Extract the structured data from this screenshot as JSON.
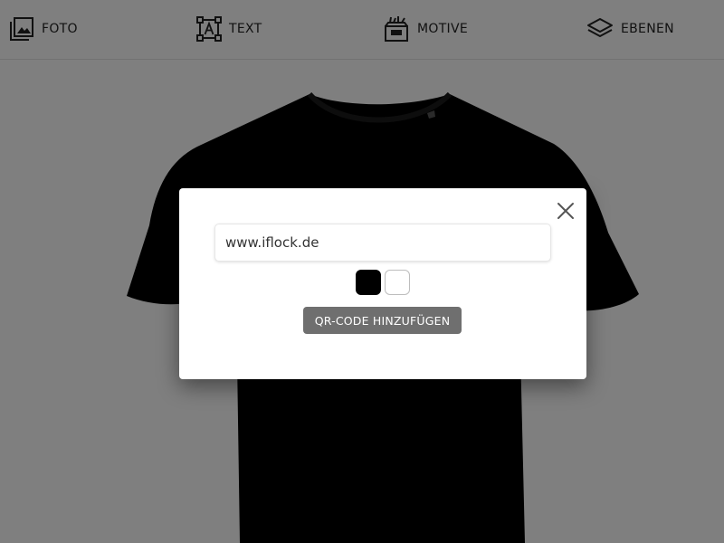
{
  "toolbar": {
    "items": [
      {
        "label": "FOTO",
        "icon": "image-icon"
      },
      {
        "label": "TEXT",
        "icon": "text-frame-icon"
      },
      {
        "label": "MOTIVE",
        "icon": "clipart-box-icon"
      },
      {
        "label": "EBENEN",
        "icon": "layers-icon"
      }
    ]
  },
  "canvas": {
    "product": "t-shirt",
    "shirt_color": "#000000"
  },
  "qr_modal": {
    "url_value": "www.iflock.de",
    "colors": [
      "#000000",
      "#ffffff"
    ],
    "add_button_label": "QR-CODE HINZUFÜGEN",
    "close_icon": "close-icon"
  }
}
